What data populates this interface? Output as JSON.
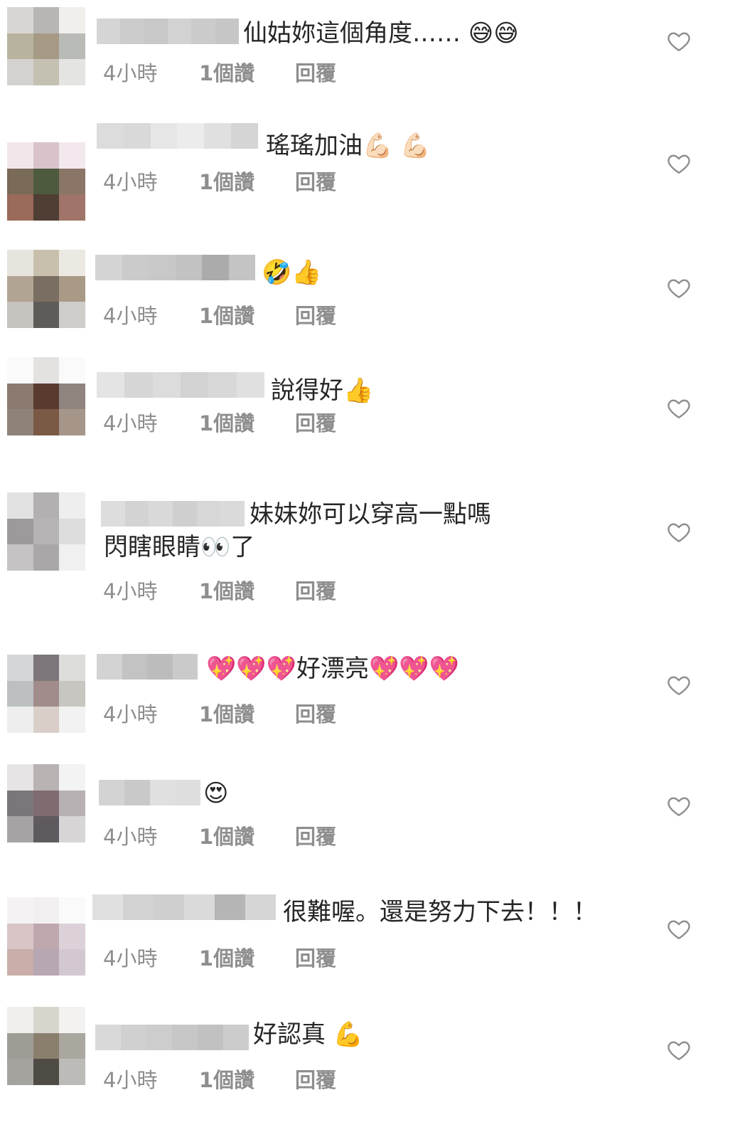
{
  "comments": [
    {
      "avatar_colors": [
        "#d8d6d2",
        "#b8b6b3",
        "#f0efec",
        "#b7b39e",
        "#a69a85",
        "#b9bbb7",
        "#d3d2ce",
        "#c4c1b3",
        "#e4e4e2"
      ],
      "username_colors": [
        "#d5d5d5",
        "#cccccc",
        "#c8c8c8",
        "#d2d2d2",
        "#cbcbcb",
        "#c6c6c6"
      ],
      "text": "仙姑妳這個角度…… 😅😅",
      "time": "4小時",
      "likes": "1個讚",
      "reply": "回覆"
    },
    {
      "avatar_colors": [
        "#f3e6ea",
        "#d9c2c9",
        "#f3e8ee",
        "#7a6a58",
        "#4e5a3e",
        "#8a7566",
        "#9a6a5a",
        "#4f3e33",
        "#a07468"
      ],
      "username_colors": [
        "#dcdcdc",
        "#d9d9d9",
        "#e6e6e6",
        "#ececec",
        "#e0e0e0",
        "#d5d5d5"
      ],
      "text": "瑤瑤加油💪🏻 💪🏻",
      "time": "4小時",
      "likes": "1個讚",
      "reply": "回覆"
    },
    {
      "avatar_colors": [
        "#e7e4de",
        "#c8c0ad",
        "#ece9e3",
        "#b1a492",
        "#7a6e62",
        "#a99a86",
        "#c6c3bf",
        "#5e5b58",
        "#cfcdca"
      ],
      "username_colors": [
        "#d4d4d4",
        "#cbcbcb",
        "#c8c8c8",
        "#c2c2c2",
        "#ababab",
        "#c4c4c4"
      ],
      "text": "🤣👍",
      "time": "4小時",
      "likes": "1個讚",
      "reply": "回覆"
    },
    {
      "avatar_colors": [
        "#fbfafa",
        "#e3e2e1",
        "#fbfafa",
        "#8a7a70",
        "#5a3a2e",
        "#8f847e",
        "#8f8279",
        "#7a5a45",
        "#a59689"
      ],
      "username_colors": [
        "#e4e4e4",
        "#d6d6d6",
        "#dcdcdc",
        "#d2d2d2",
        "#d8d8d8",
        "#e0e0e0"
      ],
      "text": "說得好👍",
      "time": "4小時",
      "likes": "1個讚",
      "reply": "回覆"
    },
    {
      "avatar_colors": [
        "#e3e2e3",
        "#b3b0b2",
        "#eeeeee",
        "#9d9a9c",
        "#b6b3b4",
        "#dedddd",
        "#c6c3c5",
        "#aaa7a9",
        "#f1f0f0"
      ],
      "username_colors": [
        "#dddddd",
        "#d3d3d3",
        "#d9d9d9",
        "#cfcfcf",
        "#d7d7d7",
        "#dadada"
      ],
      "text": "妹妹妳可以穿高一點嗎",
      "text2": "閃瞎眼睛👀了",
      "time": "4小時",
      "likes": "1個讚",
      "reply": "回覆"
    },
    {
      "avatar_colors": [
        "#d5d6d9",
        "#7c7579",
        "#dcdcda",
        "#bcc0c0",
        "#a18b8b",
        "#c8c6c0",
        "#eeeeee",
        "#d9cfc8",
        "#f2f2f2"
      ],
      "username_colors": [
        "#d3d3d3",
        "#c3c3c3",
        "#bcbcbc",
        "#cacaca"
      ],
      "text": "💖💖💖好漂亮💖💖💖",
      "time": "4小時",
      "likes": "1個讚",
      "reply": "回覆"
    },
    {
      "avatar_colors": [
        "#e6e4e4",
        "#b8b2b3",
        "#f4f3f3",
        "#7a777c",
        "#7e6c70",
        "#b8b1b3",
        "#a7a3a5",
        "#5f5a60",
        "#d7d5d6"
      ],
      "username_colors": [
        "#d3d3d3",
        "#c9c9c9",
        "#e0e0e0",
        "#dedede"
      ],
      "text": "😍",
      "time": "4小時",
      "likes": "1個讚",
      "reply": "回覆"
    },
    {
      "avatar_colors": [
        "#f5f2f3",
        "#f2eff1",
        "#fafafa",
        "#d9c5c6",
        "#bfa7ae",
        "#dcd1d8",
        "#c9aeaa",
        "#b7a7b3",
        "#d3c8d1"
      ],
      "username_colors": [
        "#e0e0e0",
        "#d2d2d2",
        "#cfcfcf",
        "#dadada",
        "#b5b5b5",
        "#d6d6d6"
      ],
      "text": "很難喔。還是努力下去！！！",
      "time": "4小時",
      "likes": "1個讚",
      "reply": "回覆"
    },
    {
      "avatar_colors": [
        "#f0efec",
        "#d8d5cc",
        "#f3f2f0",
        "#9f9c95",
        "#8a7e6d",
        "#aaa79f",
        "#a5a39e",
        "#4e4a44",
        "#bdbbb7"
      ],
      "username_colors": [
        "#d9d9d9",
        "#d0d0d0",
        "#cdcdcd",
        "#c7c7c7",
        "#c1c1c1",
        "#cccccc"
      ],
      "text": "好認真 💪",
      "time": "4小時",
      "likes": "1個讚",
      "reply": "回覆"
    }
  ],
  "colors": {
    "meta_text": "#8e8e8e",
    "comment_text": "#262626",
    "heart_stroke": "#8e8e8e"
  },
  "icons": {
    "like": "heart-outline-icon"
  }
}
